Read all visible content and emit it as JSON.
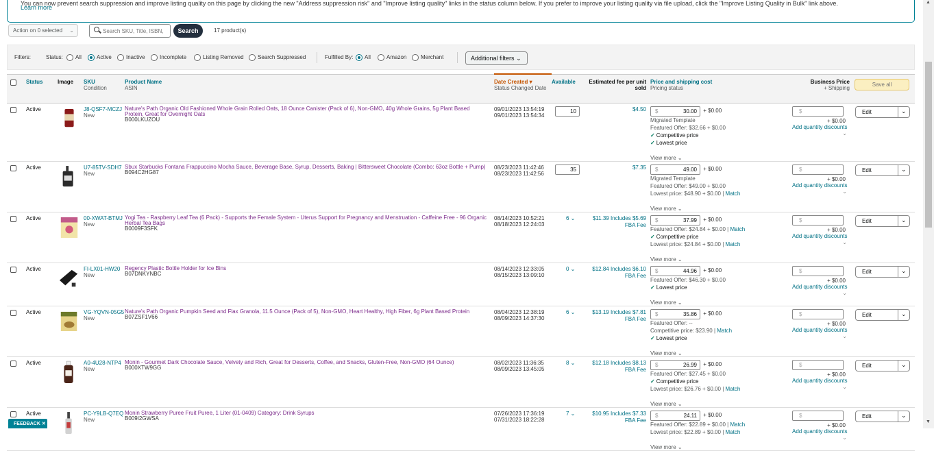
{
  "banner": {
    "text": "You can now prevent search suppression and improve listing quality on this page by clicking the new \"Address suppression risk\" and \"Improve listing quality\" links in the status column below. If you prefer to improve your listing quality via file upload, click the \"Improve Listing Quality in Bulk\" link above.",
    "learn_more": "Learn more"
  },
  "toolbar": {
    "action_label": "Action on 0 selected",
    "search_placeholder": "Search SKU, Title, ISBN,",
    "search_button": "Search",
    "product_count": "17 product(s)"
  },
  "filters": {
    "label": "Filters:",
    "status_label": "Status:",
    "status_options": [
      "All",
      "Active",
      "Inactive",
      "Incomplete",
      "Listing Removed",
      "Search Suppressed"
    ],
    "status_selected": "Active",
    "fulfilled_label": "Fulfilled By:",
    "fulfilled_options": [
      "All",
      "Amazon",
      "Merchant"
    ],
    "fulfilled_selected": "All",
    "additional": "Additional filters"
  },
  "headers": {
    "status": "Status",
    "image": "Image",
    "sku": "SKU",
    "sku_sub": "Condition",
    "name": "Product Name",
    "name_sub": "ASIN",
    "date": "Date Created",
    "date_sub": "Status Changed Date",
    "available": "Available",
    "fee": "Estimated fee per unit sold",
    "price": "Price and shipping cost",
    "price_sub": "Pricing status",
    "business": "Business Price",
    "business_sub": "+ Shipping",
    "save_all": "Save all"
  },
  "common": {
    "view_more": "View more",
    "add_qty": "Add quantity discounts",
    "edit": "Edit",
    "ship_zero": "+ $0.00",
    "dollar": "$"
  },
  "rows": [
    {
      "status": "Active",
      "sku": "J8-QSF7-MCZJ",
      "condition": "New",
      "name": "Nature's Path Organic Old Fashioned Whole Grain Rolled Oats, 18 Ounce Canister (Pack of 6), Non-GMO, 40g Whole Grains, 5g Plant Based Protein, Great for Overnight Oats",
      "asin": "B000LKUZOU",
      "created": "09/01/2023 13:54:19",
      "changed": "09/01/2023 13:54:34",
      "available": "10",
      "fee": "$4.50",
      "price": "30.00",
      "lines": [
        {
          "t": "Migrated Template"
        },
        {
          "t": "Featured Offer: $32.66 + $0.00"
        },
        {
          "t": "Competitive price",
          "ok": true
        },
        {
          "t": "Lowest price",
          "ok": true
        }
      ]
    },
    {
      "status": "Active",
      "sku": "U7-85TV-SDH7",
      "condition": "New",
      "name": "Sbux Starbucks Fontana Frappuccino Mocha Sauce, Beverage Base, Syrup, Desserts, Baking | Bittersweet Chocolate (Combo: 63oz Bottle + Pump)",
      "asin": "B094C2HG87",
      "created": "08/23/2023 11:42:46",
      "changed": "08/23/2023 11:42:56",
      "available": "35",
      "fee": "$7.35",
      "price": "49.00",
      "lines": [
        {
          "t": "Migrated Template"
        },
        {
          "t": "Featured Offer: $49.00 + $0.00"
        },
        {
          "t": "Lowest price: $48.90 + $0.00",
          "match": true
        }
      ]
    },
    {
      "status": "Active",
      "sku": "00-XWAT-BTMJ",
      "condition": "New",
      "name": "Yogi Tea - Raspberry Leaf Tea (6 Pack) - Supports the Female System - Uterus Support for Pregnancy and Menstruation - Caffeine Free - 96 Organic Herbal Tea Bags",
      "asin": "B0009F3SFK",
      "created": "08/14/2023 10:52:21",
      "changed": "08/18/2023 12:24:03",
      "available": "6",
      "fee": "$11.39 Includes $5.69 FBA Fee",
      "price": "37.99",
      "lines": [
        {
          "t": "Featured Offer: $24.84 + $0.00",
          "match": true
        },
        {
          "t": "Competitive price",
          "ok": true
        },
        {
          "t": "Lowest price: $24.84 + $0.00",
          "match": true
        }
      ]
    },
    {
      "status": "Active",
      "sku": "FI-LX01-HW20",
      "condition": "New",
      "name": "Regency Plastic Bottle Holder for Ice Bins",
      "asin": "B07DNKYNBC",
      "created": "08/14/2023 12:33:05",
      "changed": "08/15/2023 13:09:10",
      "available": "0",
      "fee": "$12.84 Includes $6.10 FBA Fee",
      "price": "44.96",
      "lines": [
        {
          "t": "Featured Offer: $46.30 + $0.00"
        },
        {
          "t": "Lowest price",
          "ok": true
        }
      ]
    },
    {
      "status": "Active",
      "sku": "VG-YQVN-05G5",
      "condition": "New",
      "name": "Nature's Path Organic Pumpkin Seed and Flax Granola, 11.5 Ounce (Pack of 5), Non-GMO, Heart Healthy, High Fiber, 6g Plant Based Protein",
      "asin": "B07ZSF1V66",
      "created": "08/04/2023 12:38:19",
      "changed": "08/09/2023 14:37:30",
      "available": "6",
      "fee": "$13.19 Includes $7.81 FBA Fee",
      "price": "35.86",
      "lines": [
        {
          "t": "Featured Offer: --"
        },
        {
          "t": "Competitive price: $23.90",
          "match": true
        },
        {
          "t": "Lowest price",
          "ok": true
        }
      ]
    },
    {
      "status": "Active",
      "sku": "A0-4U28-NTP4",
      "condition": "New",
      "name": "Monin - Gourmet Dark Chocolate Sauce, Velvety and Rich, Great for Desserts, Coffee, and Snacks, Gluten-Free, Non-GMO (64 Ounce)",
      "asin": "B000XTW9GG",
      "created": "08/02/2023 11:36:35",
      "changed": "08/09/2023 13:45:05",
      "available": "8",
      "fee": "$12.18 Includes $8.13 FBA Fee",
      "price": "26.99",
      "lines": [
        {
          "t": "Featured Offer: $27.45 + $0.00"
        },
        {
          "t": "Competitive price",
          "ok": true
        },
        {
          "t": "Lowest price: $26.76 + $0.00",
          "match": true
        }
      ]
    },
    {
      "status": "Active",
      "sku": "PC-Y9LB-Q7EQ",
      "condition": "New",
      "name": "Monin Strawberry Puree Fruit Puree, 1 Liter (01-0409) Category: Drink Syrups",
      "asin": "B009I2GWSA",
      "created": "07/26/2023 17:36:19",
      "changed": "07/31/2023 18:22:28",
      "available": "7",
      "fee": "$10.95 Includes $7.33 FBA Fee",
      "price": "24.11",
      "lines": [
        {
          "t": "Featured Offer: $22.89 + $0.00",
          "match": true
        },
        {
          "t": "Lowest price: $22.89 + $0.00",
          "match": true
        }
      ]
    }
  ],
  "match_label": "Match",
  "feedback": "FEEDBACK ✕",
  "colors": {
    "accent": "#007185",
    "brand_dark": "#232f3e",
    "banner_border": "#008296",
    "sort_orange": "#c45500"
  }
}
